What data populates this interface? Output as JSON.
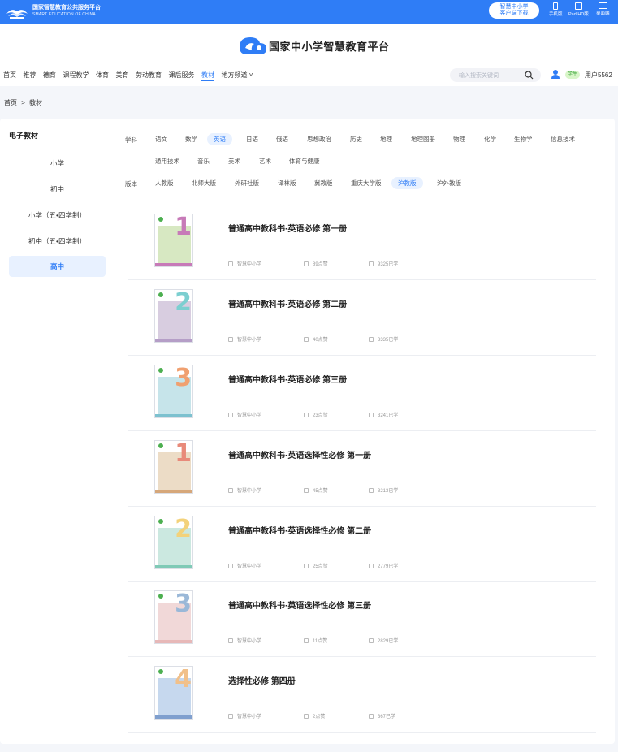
{
  "topbar": {
    "org_name": "国家智慧教育公共服务平台",
    "org_name_en": "SMART EDUCATION OF CHINA",
    "download_line1": "智慧中小学",
    "download_line2": "客户端下载",
    "devices": [
      "手机版",
      "Pad HD版",
      "桌面端"
    ]
  },
  "header": {
    "brand": "国家中小学智慧教育平台",
    "nav": [
      "首页",
      "推荐",
      "德育",
      "课程教学",
      "体育",
      "美育",
      "劳动教育",
      "课后服务",
      "教材",
      "地方频道 ˅"
    ],
    "nav_active": 8,
    "search_placeholder": "输入搜索关键词",
    "role": "学生",
    "user": "用户5562"
  },
  "breadcrumb": [
    "首页",
    ">",
    "教材"
  ],
  "sidebar": {
    "title": "电子教材",
    "items": [
      "小学",
      "初中",
      "小学（五•四学制）",
      "初中（五•四学制）",
      "高中"
    ],
    "active": 4
  },
  "filters": {
    "subject_label": "学科",
    "subjects_row1": [
      "语文",
      "数学",
      "英语",
      "日语",
      "俄语",
      "思想政治",
      "历史",
      "地理",
      "地理图册",
      "物理",
      "化学",
      "生物学",
      "信息技术"
    ],
    "subjects_row2": [
      "通用技术",
      "音乐",
      "美术",
      "艺术",
      "体育与健康"
    ],
    "subject_active": "英语",
    "edition_label": "版本",
    "editions": [
      "人教版",
      "北师大版",
      "外研社版",
      "译林版",
      "冀教版",
      "重庆大学版",
      "沪教版",
      "沪外教版"
    ],
    "edition_active": "沪教版"
  },
  "books": [
    {
      "title": "普通高中教科书·英语必修 第一册",
      "publisher": "智慧中小学",
      "likes": "89点赞",
      "learners": "9325已学",
      "num": "1",
      "accent": "#c77ab8",
      "tint": "#d7e8c2"
    },
    {
      "title": "普通高中教科书·英语必修 第二册",
      "publisher": "智慧中小学",
      "likes": "40点赞",
      "learners": "3335已学",
      "num": "2",
      "accent": "#7ccfd0",
      "tint": "#d8cde0"
    },
    {
      "title": "普通高中教科书·英语必修 第三册",
      "publisher": "智慧中小学",
      "likes": "23点赞",
      "learners": "3241已学",
      "num": "3",
      "accent": "#f0a070",
      "tint": "#c6e4ea"
    },
    {
      "title": "普通高中教科书·英语选择性必修 第一册",
      "publisher": "智慧中小学",
      "likes": "45点赞",
      "learners": "3213已学",
      "num": "1",
      "accent": "#e88a7a",
      "tint": "#ecdcc6"
    },
    {
      "title": "普通高中教科书·英语选择性必修 第二册",
      "publisher": "智慧中小学",
      "likes": "25点赞",
      "learners": "2779已学",
      "num": "2",
      "accent": "#f3d27a",
      "tint": "#cbe8e0"
    },
    {
      "title": "普通高中教科书·英语选择性必修 第三册",
      "publisher": "智慧中小学",
      "likes": "11点赞",
      "learners": "2829已学",
      "num": "3",
      "accent": "#9ab8d8",
      "tint": "#f1d8d8"
    },
    {
      "title": "选择性必修 第四册",
      "publisher": "智慧中小学",
      "likes": "2点赞",
      "learners": "367已学",
      "num": "4",
      "accent": "#f1c08a",
      "tint": "#c6d8ee"
    }
  ],
  "colors": {
    "brand_blue": "#2f7df6",
    "active_bg": "#e8f1ff"
  }
}
